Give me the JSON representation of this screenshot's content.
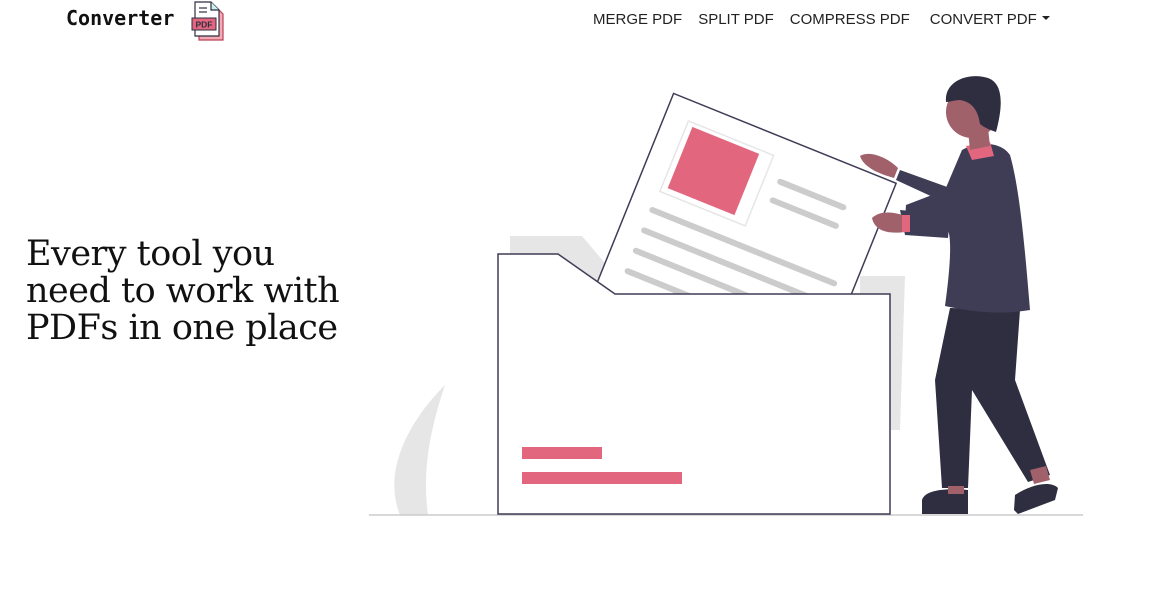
{
  "brand": {
    "name": "Converter",
    "logo_icon": "pdf-file-icon",
    "logo_text": "PDF"
  },
  "nav": {
    "items": [
      {
        "label": "MERGE PDF"
      },
      {
        "label": "SPLIT PDF"
      },
      {
        "label": "COMPRESS PDF"
      },
      {
        "label": "CONVERT PDF"
      }
    ]
  },
  "hero": {
    "title_line1": "Every tool you",
    "title_line2": "need to work with",
    "title_line3": "PDFs in one place"
  },
  "colors": {
    "accent": "#e2677e",
    "ink": "#3f3d56",
    "dark": "#2f2e41",
    "skin": "#a0616a",
    "gray": "#e6e6e6",
    "line": "#cccccc"
  }
}
